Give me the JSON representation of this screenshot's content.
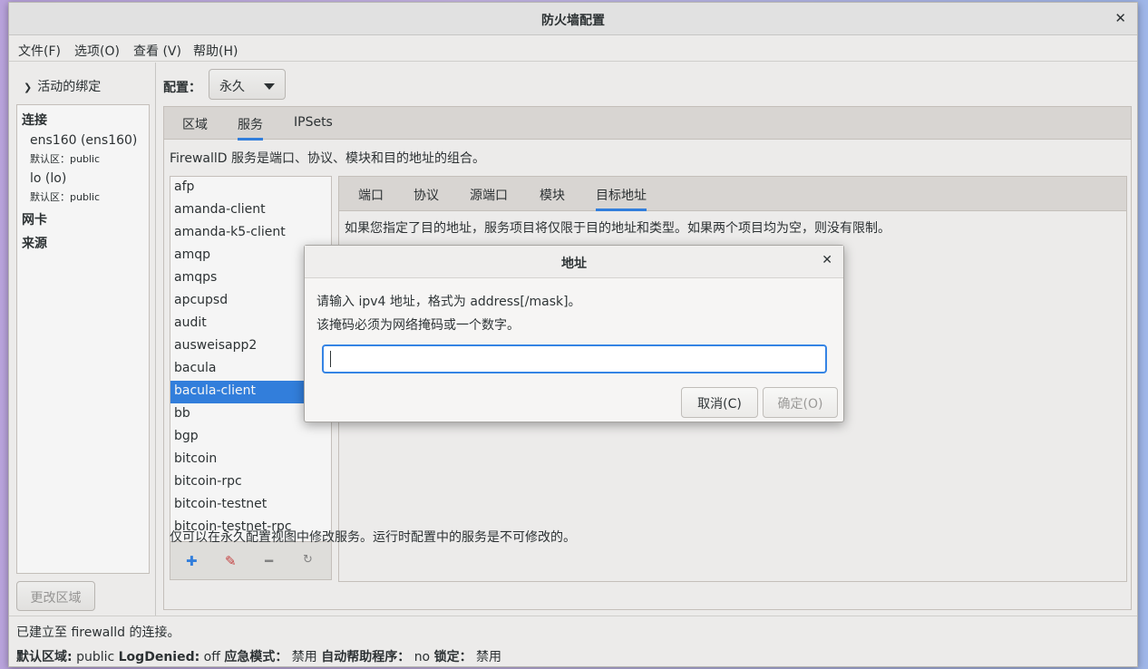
{
  "window": {
    "title": "防火墙配置"
  },
  "menu": {
    "file": "文件(F)",
    "options": "选项(O)",
    "view": "查看 (V)",
    "help": "帮助(H)"
  },
  "bindings": {
    "toggle_label": "活动的绑定",
    "connections_header": "连接",
    "connections": [
      {
        "name": "ens160 (ens160)",
        "zone": "默认区：public"
      },
      {
        "name": "lo (lo)",
        "zone": "默认区：public"
      }
    ],
    "nics_header": "网卡",
    "sources_header": "来源",
    "change_zone_button": "更改区域"
  },
  "config": {
    "label": "配置：",
    "value": "永久"
  },
  "outer_tabs": [
    "区域",
    "服务",
    "IPSets"
  ],
  "outer_active_tab": "服务",
  "services": {
    "description": "FirewallD 服务是端口、协议、模块和目的地址的组合。",
    "items": [
      "afp",
      "amanda-client",
      "amanda-k5-client",
      "amqp",
      "amqps",
      "apcupsd",
      "audit",
      "ausweisapp2",
      "bacula",
      "bacula-client",
      "bb",
      "bgp",
      "bitcoin",
      "bitcoin-rpc",
      "bitcoin-testnet",
      "bitcoin-testnet-rpc"
    ],
    "selected": "bacula-client",
    "inner_tabs": [
      "端口",
      "协议",
      "源端口",
      "模块",
      "目标地址"
    ],
    "inner_active_tab": "目标地址",
    "destination_description": "如果您指定了目的地址，服务项目将仅限于目的地址和类型。如果两个项目均为空，则没有限制。",
    "hint": "仅可以在永久配置视图中修改服务。运行时配置中的服务是不可修改的。",
    "tool_icons": [
      "plus-icon",
      "edit-icon",
      "minus-icon",
      "reload-icon"
    ]
  },
  "status": {
    "connection": "已建立至 firewalld 的连接。",
    "default_zone_label": "默认区域:",
    "default_zone_value": "public",
    "logdenied_label": "LogDenied:",
    "logdenied_value": "off",
    "panic_label": "应急模式：",
    "panic_value": "禁用",
    "helper_label": "自动帮助程序：",
    "helper_value": "no",
    "lock_label": "锁定：",
    "lock_value": "禁用"
  },
  "dialog": {
    "title": "地址",
    "line1": "请输入 ipv4 地址，格式为 address[/mask]。",
    "line2": "该掩码必须为网络掩码或一个数字。",
    "input_value": "",
    "cancel": "取消(C)",
    "ok": "确定(O)"
  }
}
